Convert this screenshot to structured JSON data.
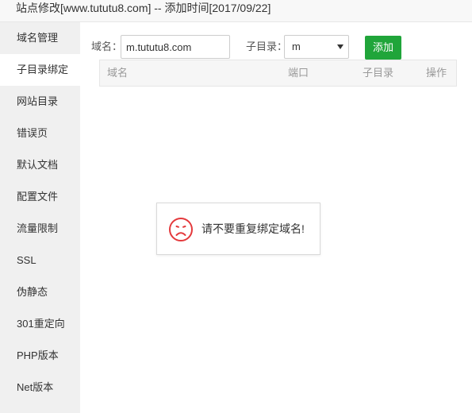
{
  "window": {
    "title": "站点修改[www.tututu8.com] -- 添加时间[2017/09/22]"
  },
  "sidebar": {
    "items": [
      {
        "label": "域名管理"
      },
      {
        "label": "子目录绑定",
        "active": true
      },
      {
        "label": "网站目录"
      },
      {
        "label": "错误页"
      },
      {
        "label": "默认文档"
      },
      {
        "label": "配置文件"
      },
      {
        "label": "流量限制"
      },
      {
        "label": "SSL"
      },
      {
        "label": "伪静态"
      },
      {
        "label": "301重定向"
      },
      {
        "label": "PHP版本"
      },
      {
        "label": "Net版本"
      }
    ]
  },
  "form": {
    "domain_label": "域名：",
    "domain_value": "m.tututu8.com",
    "subdir_label": "子目录：",
    "subdir_value": "m",
    "add_label": "添加"
  },
  "table": {
    "columns": [
      "域名",
      "端口",
      "子目录",
      "操作"
    ]
  },
  "toast": {
    "message": "请不要重复绑定域名!",
    "icon": "sad-face-icon"
  },
  "colors": {
    "accent_green": "#20a53a",
    "error_red": "#e4393c"
  }
}
